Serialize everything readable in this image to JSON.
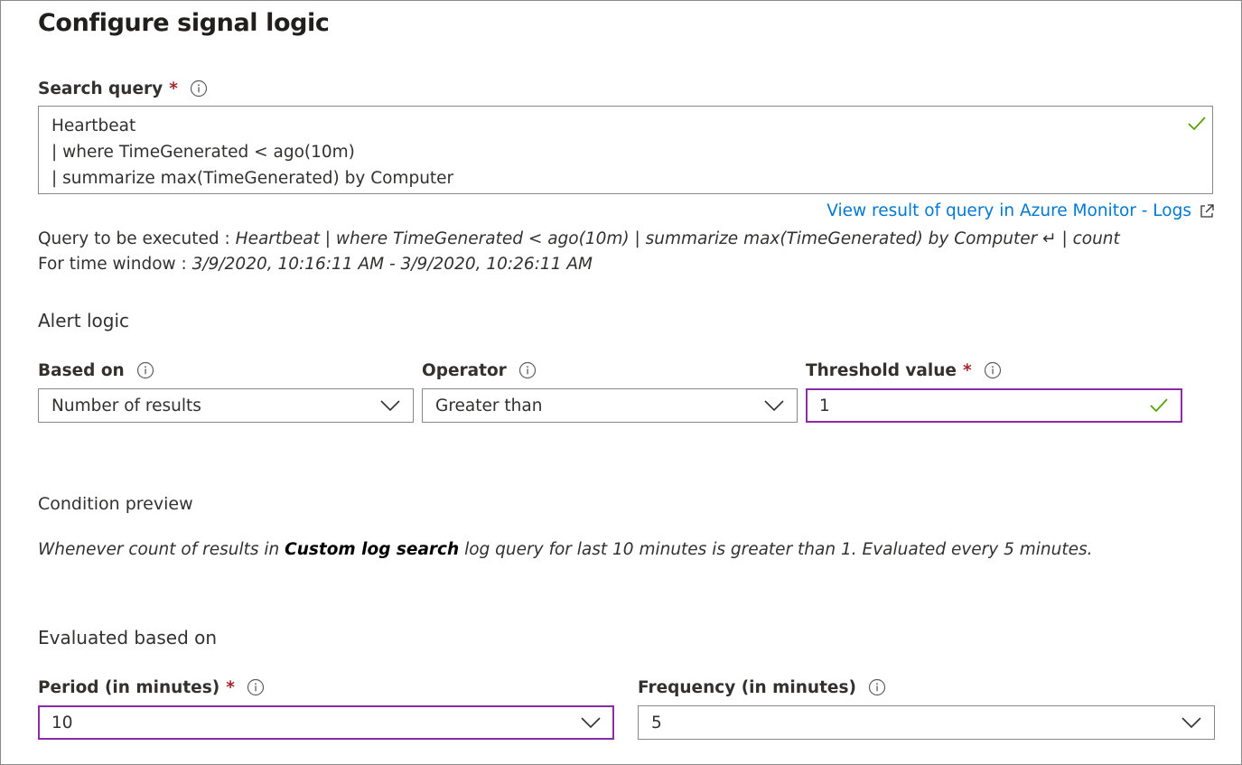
{
  "title": "Configure signal logic",
  "search_query": {
    "label": "Search query",
    "required_mark": "*",
    "value": "Heartbeat\n| where TimeGenerated < ago(10m)\n| summarize max(TimeGenerated) by Computer",
    "valid": true
  },
  "link": {
    "text": "View result of query in Azure Monitor - Logs"
  },
  "query_executed": {
    "prefix": "Query to be executed : ",
    "value": "Heartbeat | where TimeGenerated < ago(10m) | summarize max(TimeGenerated) by Computer ↵ | count"
  },
  "time_window": {
    "prefix": "For time window : ",
    "value": "3/9/2020, 10:16:11 AM - 3/9/2020, 10:26:11 AM"
  },
  "alert_logic": {
    "heading": "Alert logic",
    "based_on": {
      "label": "Based on",
      "value": "Number of results"
    },
    "operator": {
      "label": "Operator",
      "value": "Greater than"
    },
    "threshold": {
      "label": "Threshold value",
      "required_mark": "*",
      "value": "1",
      "valid": true
    }
  },
  "condition_preview": {
    "heading": "Condition preview",
    "before": "Whenever count of results in ",
    "bold": "Custom log search",
    "after": " log query for last 10 minutes is greater than 1. Evaluated every 5 minutes."
  },
  "evaluated": {
    "heading": "Evaluated based on",
    "period": {
      "label": "Period (in minutes)",
      "required_mark": "*",
      "value": "10"
    },
    "frequency": {
      "label": "Frequency (in minutes)",
      "value": "5"
    }
  },
  "colors": {
    "link": "#0078d4",
    "required": "#a4262c",
    "focus_border": "#8a2da5",
    "valid_check": "#57a300"
  }
}
